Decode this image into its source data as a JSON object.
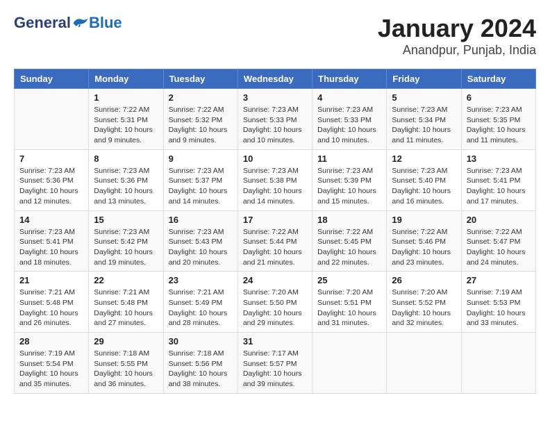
{
  "header": {
    "logo": {
      "general": "General",
      "blue": "Blue"
    },
    "title": "January 2024",
    "subtitle": "Anandpur, Punjab, India"
  },
  "weekdays": [
    "Sunday",
    "Monday",
    "Tuesday",
    "Wednesday",
    "Thursday",
    "Friday",
    "Saturday"
  ],
  "weeks": [
    [
      {
        "day": "",
        "info": ""
      },
      {
        "day": "1",
        "info": "Sunrise: 7:22 AM\nSunset: 5:31 PM\nDaylight: 10 hours\nand 9 minutes."
      },
      {
        "day": "2",
        "info": "Sunrise: 7:22 AM\nSunset: 5:32 PM\nDaylight: 10 hours\nand 9 minutes."
      },
      {
        "day": "3",
        "info": "Sunrise: 7:23 AM\nSunset: 5:33 PM\nDaylight: 10 hours\nand 10 minutes."
      },
      {
        "day": "4",
        "info": "Sunrise: 7:23 AM\nSunset: 5:33 PM\nDaylight: 10 hours\nand 10 minutes."
      },
      {
        "day": "5",
        "info": "Sunrise: 7:23 AM\nSunset: 5:34 PM\nDaylight: 10 hours\nand 11 minutes."
      },
      {
        "day": "6",
        "info": "Sunrise: 7:23 AM\nSunset: 5:35 PM\nDaylight: 10 hours\nand 11 minutes."
      }
    ],
    [
      {
        "day": "7",
        "info": "Sunrise: 7:23 AM\nSunset: 5:36 PM\nDaylight: 10 hours\nand 12 minutes."
      },
      {
        "day": "8",
        "info": "Sunrise: 7:23 AM\nSunset: 5:36 PM\nDaylight: 10 hours\nand 13 minutes."
      },
      {
        "day": "9",
        "info": "Sunrise: 7:23 AM\nSunset: 5:37 PM\nDaylight: 10 hours\nand 14 minutes."
      },
      {
        "day": "10",
        "info": "Sunrise: 7:23 AM\nSunset: 5:38 PM\nDaylight: 10 hours\nand 14 minutes."
      },
      {
        "day": "11",
        "info": "Sunrise: 7:23 AM\nSunset: 5:39 PM\nDaylight: 10 hours\nand 15 minutes."
      },
      {
        "day": "12",
        "info": "Sunrise: 7:23 AM\nSunset: 5:40 PM\nDaylight: 10 hours\nand 16 minutes."
      },
      {
        "day": "13",
        "info": "Sunrise: 7:23 AM\nSunset: 5:41 PM\nDaylight: 10 hours\nand 17 minutes."
      }
    ],
    [
      {
        "day": "14",
        "info": "Sunrise: 7:23 AM\nSunset: 5:41 PM\nDaylight: 10 hours\nand 18 minutes."
      },
      {
        "day": "15",
        "info": "Sunrise: 7:23 AM\nSunset: 5:42 PM\nDaylight: 10 hours\nand 19 minutes."
      },
      {
        "day": "16",
        "info": "Sunrise: 7:23 AM\nSunset: 5:43 PM\nDaylight: 10 hours\nand 20 minutes."
      },
      {
        "day": "17",
        "info": "Sunrise: 7:22 AM\nSunset: 5:44 PM\nDaylight: 10 hours\nand 21 minutes."
      },
      {
        "day": "18",
        "info": "Sunrise: 7:22 AM\nSunset: 5:45 PM\nDaylight: 10 hours\nand 22 minutes."
      },
      {
        "day": "19",
        "info": "Sunrise: 7:22 AM\nSunset: 5:46 PM\nDaylight: 10 hours\nand 23 minutes."
      },
      {
        "day": "20",
        "info": "Sunrise: 7:22 AM\nSunset: 5:47 PM\nDaylight: 10 hours\nand 24 minutes."
      }
    ],
    [
      {
        "day": "21",
        "info": "Sunrise: 7:21 AM\nSunset: 5:48 PM\nDaylight: 10 hours\nand 26 minutes."
      },
      {
        "day": "22",
        "info": "Sunrise: 7:21 AM\nSunset: 5:48 PM\nDaylight: 10 hours\nand 27 minutes."
      },
      {
        "day": "23",
        "info": "Sunrise: 7:21 AM\nSunset: 5:49 PM\nDaylight: 10 hours\nand 28 minutes."
      },
      {
        "day": "24",
        "info": "Sunrise: 7:20 AM\nSunset: 5:50 PM\nDaylight: 10 hours\nand 29 minutes."
      },
      {
        "day": "25",
        "info": "Sunrise: 7:20 AM\nSunset: 5:51 PM\nDaylight: 10 hours\nand 31 minutes."
      },
      {
        "day": "26",
        "info": "Sunrise: 7:20 AM\nSunset: 5:52 PM\nDaylight: 10 hours\nand 32 minutes."
      },
      {
        "day": "27",
        "info": "Sunrise: 7:19 AM\nSunset: 5:53 PM\nDaylight: 10 hours\nand 33 minutes."
      }
    ],
    [
      {
        "day": "28",
        "info": "Sunrise: 7:19 AM\nSunset: 5:54 PM\nDaylight: 10 hours\nand 35 minutes."
      },
      {
        "day": "29",
        "info": "Sunrise: 7:18 AM\nSunset: 5:55 PM\nDaylight: 10 hours\nand 36 minutes."
      },
      {
        "day": "30",
        "info": "Sunrise: 7:18 AM\nSunset: 5:56 PM\nDaylight: 10 hours\nand 38 minutes."
      },
      {
        "day": "31",
        "info": "Sunrise: 7:17 AM\nSunset: 5:57 PM\nDaylight: 10 hours\nand 39 minutes."
      },
      {
        "day": "",
        "info": ""
      },
      {
        "day": "",
        "info": ""
      },
      {
        "day": "",
        "info": ""
      }
    ]
  ]
}
